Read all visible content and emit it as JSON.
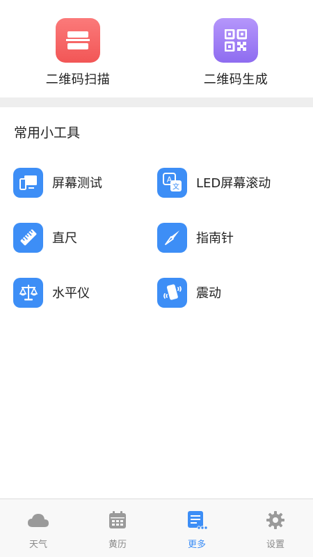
{
  "scan": {
    "scan_label": "二维码扫描",
    "generate_label": "二维码生成"
  },
  "section": {
    "title": "常用小工具"
  },
  "tools": [
    {
      "label": "屏幕测试",
      "icon": "screen-test-icon"
    },
    {
      "label": "LED屏幕滚动",
      "icon": "translate-icon"
    },
    {
      "label": "直尺",
      "icon": "ruler-icon"
    },
    {
      "label": "指南针",
      "icon": "compass-icon"
    },
    {
      "label": "水平仪",
      "icon": "balance-icon"
    },
    {
      "label": "震动",
      "icon": "vibrate-icon"
    }
  ],
  "nav": {
    "items": [
      {
        "label": "天气",
        "icon": "cloud-icon"
      },
      {
        "label": "黄历",
        "icon": "calendar-icon"
      },
      {
        "label": "更多",
        "icon": "more-list-icon",
        "active": true
      },
      {
        "label": "设置",
        "icon": "gear-icon"
      }
    ]
  },
  "colors": {
    "accent": "#3d8ef6",
    "scan_red": "#f25656",
    "generate_purple": "#8e6cf0",
    "nav_inactive": "#8a8a8a",
    "divider": "#eeeeee"
  }
}
